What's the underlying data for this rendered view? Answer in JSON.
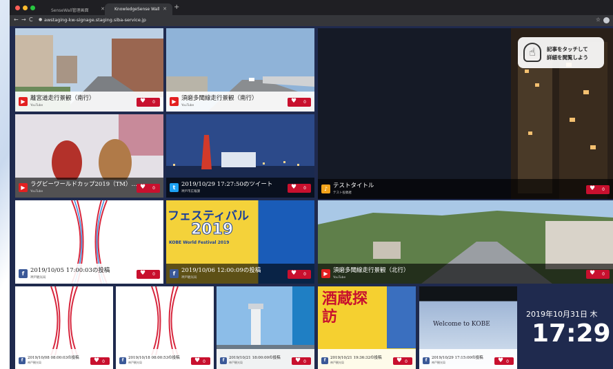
{
  "browser": {
    "tabs": [
      {
        "label": "SenseWall管理画面"
      },
      {
        "label": "KnowledgeSense Wall"
      }
    ],
    "url": "awstaging-kw-signage.staging.siba-service.jp"
  },
  "colors": {
    "background": "#1f2a4e",
    "like": "#c8102e",
    "youtube": "#e32020",
    "twitter": "#1da1f2",
    "facebook": "#3b5998"
  },
  "tiles": [
    {
      "title": "離宮道走行景観（南行）",
      "source": "YouTube",
      "likes": "0",
      "icon": "youtube-icon"
    },
    {
      "title": "須磨多聞線走行景観（南行）",
      "source": "YouTube",
      "likes": "0",
      "icon": "youtube-icon"
    },
    {
      "title": "ラグビーワールドカップ2019（TM）…",
      "source": "YouTube",
      "likes": "0",
      "icon": "youtube-icon"
    },
    {
      "title": "2019/10/29 17:27:50のツイート",
      "source": "神戸市広報課",
      "likes": "0",
      "icon": "twitter-icon"
    },
    {
      "title": "テストタイトル",
      "source": "テスト投稿者",
      "likes": "0",
      "icon": "bell-icon"
    },
    {
      "title": "2019/10/05 17:00:03の投稿",
      "source": "神戸観光局",
      "likes": "0",
      "icon": "facebook-icon"
    },
    {
      "title": "2019/10/06 12:00:09の投稿",
      "source": "神戸観光局",
      "likes": "0",
      "icon": "facebook-icon"
    },
    {
      "title": "須磨多聞線走行景観（北行）",
      "source": "YouTube",
      "likes": "0",
      "icon": "youtube-icon"
    },
    {
      "title": "2019/10/08 08:00:03の投稿",
      "source": "神戸観光局",
      "likes": "0",
      "icon": "facebook-icon"
    },
    {
      "title": "2019/10/18 08:00:53の投稿",
      "source": "神戸観光局",
      "likes": "0",
      "icon": "facebook-icon"
    },
    {
      "title": "2019/10/21 18:00:00の投稿",
      "source": "神戸観光局",
      "likes": "0",
      "icon": "facebook-icon"
    },
    {
      "title": "2019/10/21 19:36:32の投稿",
      "source": "神戸観光局",
      "likes": "0",
      "icon": "facebook-icon"
    },
    {
      "title": "2019/10/29 17:15:00の投稿",
      "source": "神戸観光局",
      "likes": "0",
      "icon": "facebook-icon"
    }
  ],
  "overlay": {
    "line1": "記事をタッチして",
    "line2": "詳細を閲覧しよう"
  },
  "clock": {
    "date": "2019年10月31日 木",
    "time": "17:29"
  },
  "poster": {
    "line1": "フェスティバル",
    "line2": "2019",
    "line3": "KOBE World Festival 2019"
  },
  "welcome": {
    "text": "Welcome to KOBE"
  },
  "sake": {
    "text": "酒蔵探訪"
  }
}
